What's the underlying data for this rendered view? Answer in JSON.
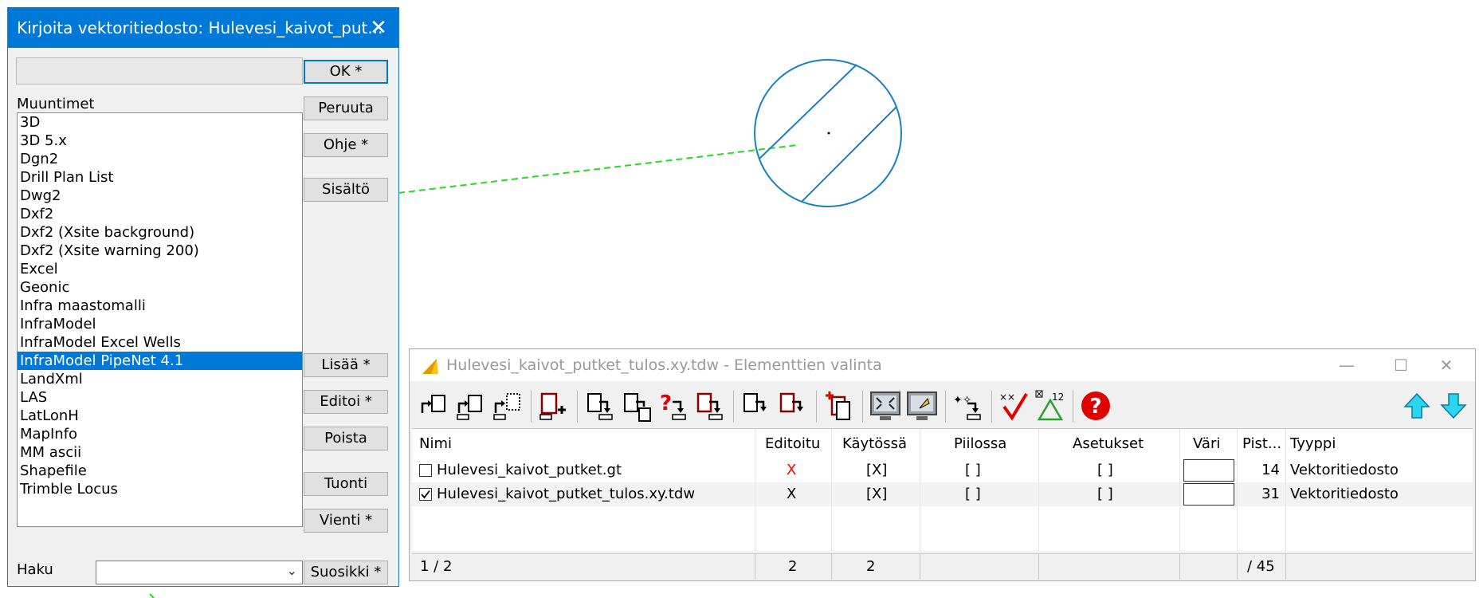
{
  "dialog": {
    "title": "Kirjoita vektoritiedosto: Hulevesi_kaivot_put...",
    "buttons": {
      "ok": "OK *",
      "cancel": "Peruuta",
      "help": "Ohje *",
      "contents": "Sisältö",
      "add": "Lisää *",
      "edit": "Editoi *",
      "delete": "Poista",
      "import": "Tuonti",
      "export": "Vienti *",
      "favorite": "Suosikki *"
    },
    "conversions_label": "Muuntimet",
    "conversions": [
      "3D",
      "3D 5.x",
      "Dgn2",
      "Drill Plan List",
      "Dwg2",
      "Dxf2",
      "Dxf2 (Xsite background)",
      "Dxf2 (Xsite warning 200)",
      "Excel",
      "Geonic",
      "Infra maastomalli",
      "InfraModel",
      "InfraModel Excel Wells",
      "InfraModel PipeNet 4.1",
      "LandXml",
      "LAS",
      "LatLonH",
      "MapInfo",
      "MM ascii",
      "Shapefile",
      "Trimble Locus"
    ],
    "selected_conversion": "InfraModel PipeNet 4.1",
    "search_label": "Haku",
    "search_value": ""
  },
  "element_window": {
    "title": "Hulevesi_kaivot_putket_tulos.xy.tdw - Elementtien valinta",
    "columns": [
      "Nimi",
      "Editoitu",
      "Käytössä",
      "Piilossa",
      "Asetukset",
      "Väri",
      "Pist...",
      "Tyyppi"
    ],
    "rows": [
      {
        "checked": false,
        "name": "Hulevesi_kaivot_putket.gt",
        "edited": "X",
        "edited_color": "#ff0000",
        "in_use": "[X]",
        "hidden": "[  ]",
        "settings": "[  ]",
        "points": "14",
        "type": "Vektoritiedosto"
      },
      {
        "checked": true,
        "name": "Hulevesi_kaivot_putket_tulos.xy.tdw",
        "edited": "X",
        "edited_color": "#000000",
        "in_use": "[X]",
        "hidden": "[  ]",
        "settings": "[  ]",
        "points": "31",
        "type": "Vektoritiedosto"
      }
    ],
    "status": {
      "position": "1 / 2",
      "edited_count": "2",
      "in_use_count": "2",
      "points_total": "/ 45"
    }
  },
  "colors": {
    "titlebar": "#0078d7",
    "selection": "#0078d7",
    "circle": "#1a7fc1",
    "dashed_line": "#22dd22"
  }
}
